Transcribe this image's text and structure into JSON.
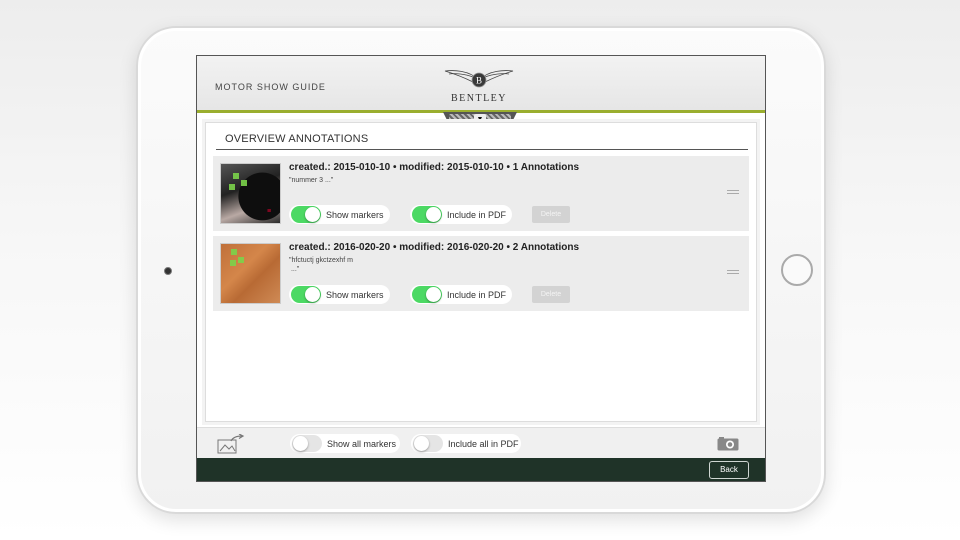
{
  "app": {
    "title": "MOTOR SHOW GUIDE",
    "brand": "BENTLEY",
    "accent_color": "#9aae2e",
    "footer_color": "#1f3328"
  },
  "grille_tab": {
    "icon": "caret-down-icon",
    "glyph": "▼"
  },
  "panel": {
    "title": "OVERVIEW ANNOTATIONS"
  },
  "annotations": [
    {
      "header": "created.: 2015-010-10 • modified: 2015-010-10 • 1 Annotations",
      "note": "\"nummer 3 ...\"",
      "show_markers": {
        "label": "Show markers",
        "on": true
      },
      "include_pdf": {
        "label": "Include in PDF",
        "on": true
      },
      "delete_label": "Delete"
    },
    {
      "header": "created.: 2016-020-20 • modified: 2016-020-20 • 2 Annotations",
      "note": "\"hfctuctj gkctzexhf m\n ...\"",
      "show_markers": {
        "label": "Show markers",
        "on": true
      },
      "include_pdf": {
        "label": "Include in PDF",
        "on": true
      },
      "delete_label": "Delete"
    }
  ],
  "toolbar": {
    "show_all_markers": {
      "label": "Show all markers",
      "on": false
    },
    "include_all_pdf": {
      "label": "Include all in PDF",
      "on": false
    },
    "export_icon": "export-image-icon",
    "camera_icon": "camera-icon"
  },
  "footer": {
    "back_label": "Back"
  },
  "toggle_on_color": "#4cd964"
}
